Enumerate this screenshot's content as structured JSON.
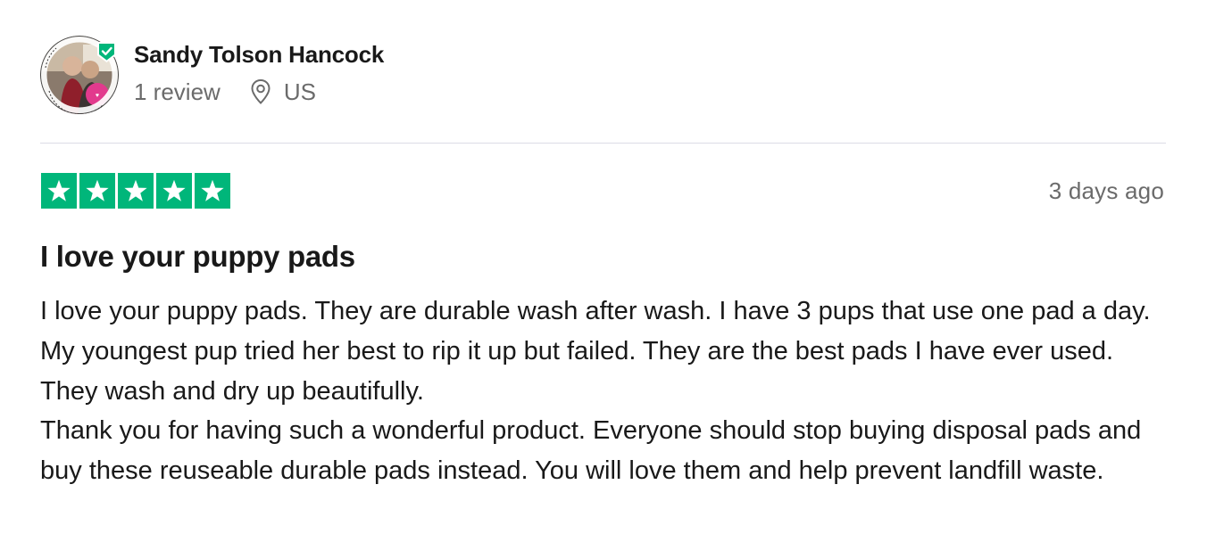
{
  "consumer": {
    "name": "Sandy Tolson Hancock",
    "review_count": "1 review",
    "location": "US",
    "avatar_icon": "profile-photo",
    "verified_icon": "verified-shield-check-icon"
  },
  "review": {
    "rating": 5,
    "rating_max": 5,
    "star_color": "#00b67a",
    "date": "3 days ago",
    "title": "I love your puppy pads",
    "paragraphs": [
      "I love your puppy pads. They are durable wash after wash. I have 3 pups that use one pad a day. My youngest pup tried her best to rip it up but failed. They are the best pads I have ever used. They wash and dry up beautifully.",
      "Thank you for having such a wonderful product. Everyone should stop buying disposal pads and buy these reuseable durable pads instead. You will love them and help prevent landfill waste."
    ]
  }
}
